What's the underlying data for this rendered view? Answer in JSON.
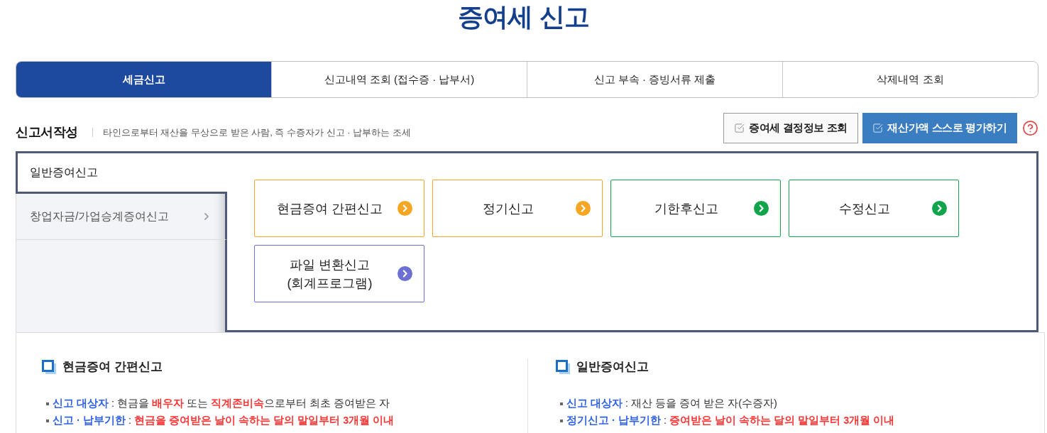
{
  "page_title": "증여세 신고",
  "tabs": [
    {
      "label": "세금신고",
      "selected": true
    },
    {
      "label": "신고내역 조회 (접수증 · 납부서)",
      "selected": false
    },
    {
      "label": "신고 부속 · 증빙서류 제출",
      "selected": false
    },
    {
      "label": "삭제내역 조회",
      "selected": false
    }
  ],
  "section": {
    "title": "신고서작성",
    "description": "타인으로부터 재산을 무상으로 받은 사람, 즉 수증자가 신고 · 납부하는 조세",
    "buttons": [
      {
        "label": "증여세 결정정보 조회",
        "kind": "secondary"
      },
      {
        "label": "재산가액 스스로 평가하기",
        "kind": "primary"
      }
    ]
  },
  "side_menu": [
    {
      "label": "일반증여신고",
      "selected": true
    },
    {
      "label": "창업자금/가업승계증여신고",
      "selected": false
    }
  ],
  "filing_cards": [
    {
      "label": "현금증여 간편신고",
      "color": "#f5a623"
    },
    {
      "label": "정기신고",
      "color": "#f5a623"
    },
    {
      "label": "기한후신고",
      "color": "#10a54a"
    },
    {
      "label": "수정신고",
      "color": "#10a54a"
    },
    {
      "label": "파일 변환신고\n(회계프로그램)",
      "color": "#6b70d2"
    }
  ],
  "info_panels": [
    {
      "title": "현금증여 간편신고",
      "bullets": [
        [
          {
            "kind": "label",
            "text": "신고 대상자"
          },
          {
            "kind": "plain",
            "text": " : 현금을 "
          },
          {
            "kind": "highlight",
            "text": "배우자"
          },
          {
            "kind": "plain",
            "text": " 또는 "
          },
          {
            "kind": "highlight",
            "text": "직계존비속"
          },
          {
            "kind": "plain",
            "text": "으로부터 최초 증여받은 자"
          }
        ],
        [
          {
            "kind": "label",
            "text": "신고 · 납부기한"
          },
          {
            "kind": "plain",
            "text": " : "
          },
          {
            "kind": "highlight",
            "text": "현금을 증여받은 날이 속하는 달의 말일부터 3개월 이내"
          }
        ]
      ]
    },
    {
      "title": "일반증여신고",
      "bullets": [
        [
          {
            "kind": "label",
            "text": "신고 대상자"
          },
          {
            "kind": "plain",
            "text": " : 재산 등을 증여 받은 자(수증자)"
          }
        ],
        [
          {
            "kind": "label",
            "text": "정기신고 · 납부기한"
          },
          {
            "kind": "plain",
            "text": " : "
          },
          {
            "kind": "highlight",
            "text": "증여받은 날이 속하는 달의 말일부터 3개월 이내"
          }
        ]
      ]
    }
  ]
}
